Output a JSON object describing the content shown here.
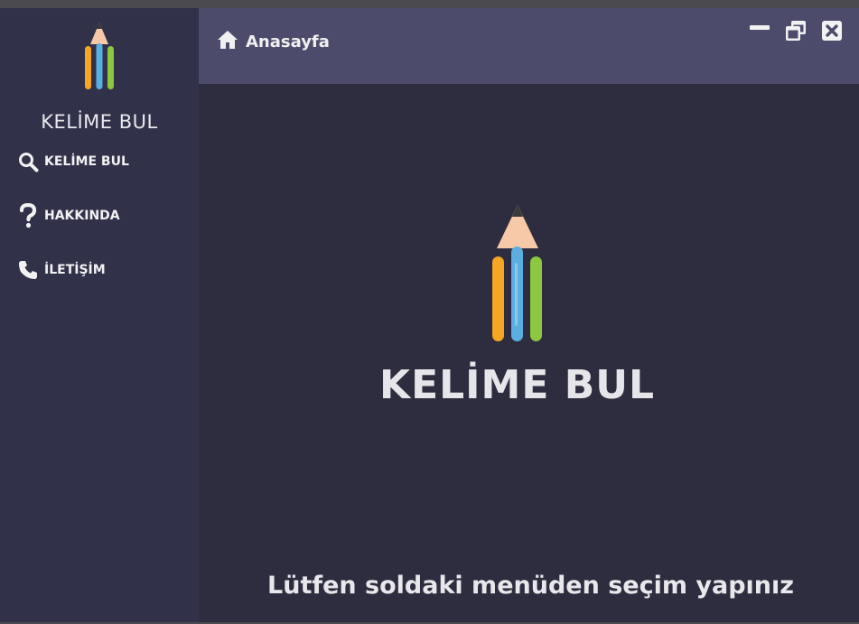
{
  "sidebar": {
    "logo_text": "KELİME BUL",
    "items": [
      {
        "label": "KELİME BUL",
        "icon": "search-icon"
      },
      {
        "label": "HAKKINDA",
        "icon": "question-icon"
      },
      {
        "label": "İLETİŞİM",
        "icon": "phone-icon"
      }
    ]
  },
  "header": {
    "breadcrumb": "Anasayfa",
    "icon": "home-icon"
  },
  "window_controls": {
    "minimize": "minimize-icon",
    "restore": "restore-icon",
    "close": "close-icon"
  },
  "main": {
    "title": "KELİME BUL",
    "hint": "Lütfen soldaki menüden seçim yapınız"
  },
  "colors": {
    "sidebar_bg": "#31314a",
    "header_bg": "#4d4b6b",
    "main_bg": "#2e2d3f",
    "pencil_orange": "#f5a623",
    "pencil_blue": "#5aaee0",
    "pencil_green": "#8dc63f",
    "pencil_tip": "#f7c9a8"
  }
}
